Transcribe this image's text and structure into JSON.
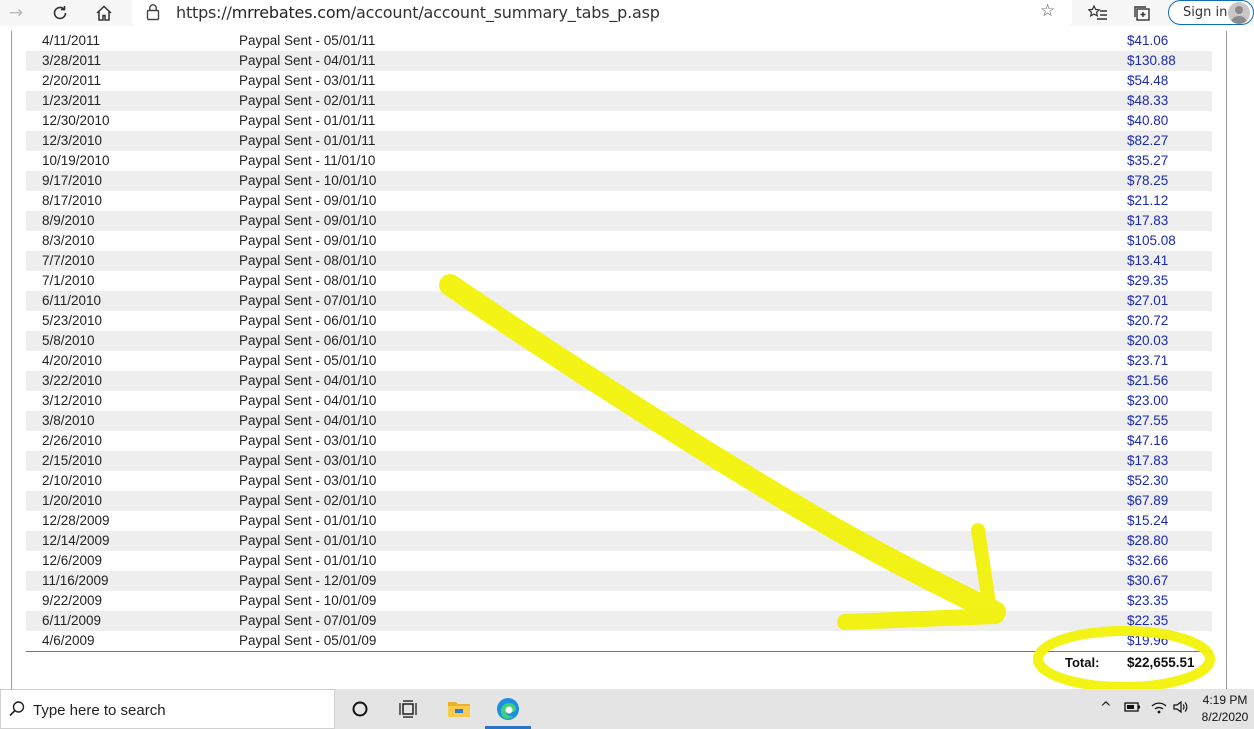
{
  "browser": {
    "url_prefix": "https://",
    "url_domain": "mrrebates.com",
    "url_path": "/account/account_summary_tabs_p.asp",
    "signin_label": "Sign in"
  },
  "payments": [
    {
      "date": "4/11/2011",
      "desc": "Paypal Sent - 05/01/11",
      "amount": "$41.06"
    },
    {
      "date": "3/28/2011",
      "desc": "Paypal Sent - 04/01/11",
      "amount": "$130.88"
    },
    {
      "date": "2/20/2011",
      "desc": "Paypal Sent - 03/01/11",
      "amount": "$54.48"
    },
    {
      "date": "1/23/2011",
      "desc": "Paypal Sent - 02/01/11",
      "amount": "$48.33"
    },
    {
      "date": "12/30/2010",
      "desc": "Paypal Sent - 01/01/11",
      "amount": "$40.80"
    },
    {
      "date": "12/3/2010",
      "desc": "Paypal Sent - 01/01/11",
      "amount": "$82.27"
    },
    {
      "date": "10/19/2010",
      "desc": "Paypal Sent - 11/01/10",
      "amount": "$35.27"
    },
    {
      "date": "9/17/2010",
      "desc": "Paypal Sent - 10/01/10",
      "amount": "$78.25"
    },
    {
      "date": "8/17/2010",
      "desc": "Paypal Sent - 09/01/10",
      "amount": "$21.12"
    },
    {
      "date": "8/9/2010",
      "desc": "Paypal Sent - 09/01/10",
      "amount": "$17.83"
    },
    {
      "date": "8/3/2010",
      "desc": "Paypal Sent - 09/01/10",
      "amount": "$105.08"
    },
    {
      "date": "7/7/2010",
      "desc": "Paypal Sent - 08/01/10",
      "amount": "$13.41"
    },
    {
      "date": "7/1/2010",
      "desc": "Paypal Sent - 08/01/10",
      "amount": "$29.35"
    },
    {
      "date": "6/11/2010",
      "desc": "Paypal Sent - 07/01/10",
      "amount": "$27.01"
    },
    {
      "date": "5/23/2010",
      "desc": "Paypal Sent - 06/01/10",
      "amount": "$20.72"
    },
    {
      "date": "5/8/2010",
      "desc": "Paypal Sent - 06/01/10",
      "amount": "$20.03"
    },
    {
      "date": "4/20/2010",
      "desc": "Paypal Sent - 05/01/10",
      "amount": "$23.71"
    },
    {
      "date": "3/22/2010",
      "desc": "Paypal Sent - 04/01/10",
      "amount": "$21.56"
    },
    {
      "date": "3/12/2010",
      "desc": "Paypal Sent - 04/01/10",
      "amount": "$23.00"
    },
    {
      "date": "3/8/2010",
      "desc": "Paypal Sent - 04/01/10",
      "amount": "$27.55"
    },
    {
      "date": "2/26/2010",
      "desc": "Paypal Sent - 03/01/10",
      "amount": "$47.16"
    },
    {
      "date": "2/15/2010",
      "desc": "Paypal Sent - 03/01/10",
      "amount": "$17.83"
    },
    {
      "date": "2/10/2010",
      "desc": "Paypal Sent - 03/01/10",
      "amount": "$52.30"
    },
    {
      "date": "1/20/2010",
      "desc": "Paypal Sent - 02/01/10",
      "amount": "$67.89"
    },
    {
      "date": "12/28/2009",
      "desc": "Paypal Sent - 01/01/10",
      "amount": "$15.24"
    },
    {
      "date": "12/14/2009",
      "desc": "Paypal Sent - 01/01/10",
      "amount": "$28.80"
    },
    {
      "date": "12/6/2009",
      "desc": "Paypal Sent - 01/01/10",
      "amount": "$32.66"
    },
    {
      "date": "11/16/2009",
      "desc": "Paypal Sent - 12/01/09",
      "amount": "$30.67"
    },
    {
      "date": "9/22/2009",
      "desc": "Paypal Sent - 10/01/09",
      "amount": "$23.35"
    },
    {
      "date": "6/11/2009",
      "desc": "Paypal Sent - 07/01/09",
      "amount": "$22.35"
    },
    {
      "date": "4/6/2009",
      "desc": "Paypal Sent - 05/01/09",
      "amount": "$19.96"
    }
  ],
  "total": {
    "label": "Total:",
    "value": "$22,655.51"
  },
  "taskbar": {
    "search_placeholder": "Type here to search",
    "time": "4:19 PM",
    "date": "8/2/2020"
  },
  "colors": {
    "amount_link": "#1a2ab0",
    "row_shade": "#eeeeee",
    "highlighter": "#f2f20a",
    "edge_accent": "#2a73c8"
  }
}
